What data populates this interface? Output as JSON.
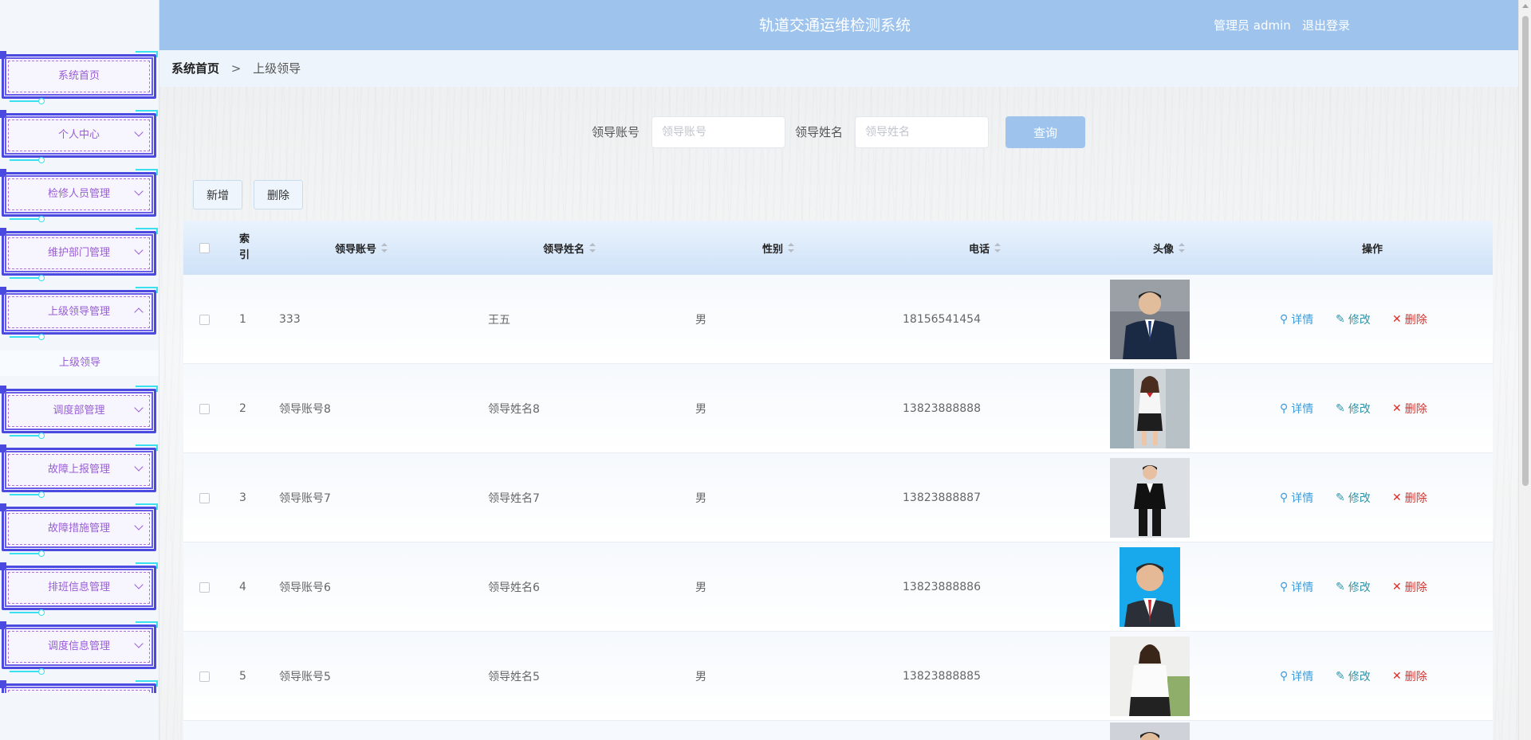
{
  "header": {
    "app_title": "轨道交通运维检测系统",
    "user": "管理员 admin",
    "logout": "退出登录"
  },
  "breadcrumb": {
    "home": "系统首页",
    "separator": ">",
    "current": "上级领导"
  },
  "sidebar": {
    "items": [
      {
        "label": "系统首页"
      },
      {
        "label": "个人中心"
      },
      {
        "label": "检修人员管理"
      },
      {
        "label": "维护部门管理"
      },
      {
        "label": "上级领导管理"
      },
      {
        "label": "调度部管理"
      },
      {
        "label": "故障上报管理"
      },
      {
        "label": "故障措施管理"
      },
      {
        "label": "排班信息管理"
      },
      {
        "label": "调度信息管理"
      }
    ],
    "submenu": {
      "label": "上级领导"
    }
  },
  "search": {
    "account_label": "领导账号",
    "account_placeholder": "领导账号",
    "name_label": "领导姓名",
    "name_placeholder": "领导姓名",
    "query_button": "查询"
  },
  "actions": {
    "add": "新增",
    "delete": "删除"
  },
  "table": {
    "headers": {
      "index": "索引",
      "account": "领导账号",
      "name": "领导姓名",
      "gender": "性别",
      "phone": "电话",
      "avatar": "头像",
      "operation": "操作"
    },
    "ops": {
      "detail": "详情",
      "edit": "修改",
      "delete": "删除"
    },
    "rows": [
      {
        "index": "1",
        "account": "333",
        "name": "王五",
        "gender": "男",
        "phone": "18156541454"
      },
      {
        "index": "2",
        "account": "领导账号8",
        "name": "领导姓名8",
        "gender": "男",
        "phone": "13823888888"
      },
      {
        "index": "3",
        "account": "领导账号7",
        "name": "领导姓名7",
        "gender": "男",
        "phone": "13823888887"
      },
      {
        "index": "4",
        "account": "领导账号6",
        "name": "领导姓名6",
        "gender": "男",
        "phone": "13823888886"
      },
      {
        "index": "5",
        "account": "领导账号5",
        "name": "领导姓名5",
        "gender": "男",
        "phone": "13823888885"
      }
    ]
  },
  "colors": {
    "header_bg": "#9ec4ee",
    "menu_text": "#9a5cd6",
    "detail": "#3a9ad9",
    "edit": "#2f96a8",
    "delete": "#d9302a"
  }
}
